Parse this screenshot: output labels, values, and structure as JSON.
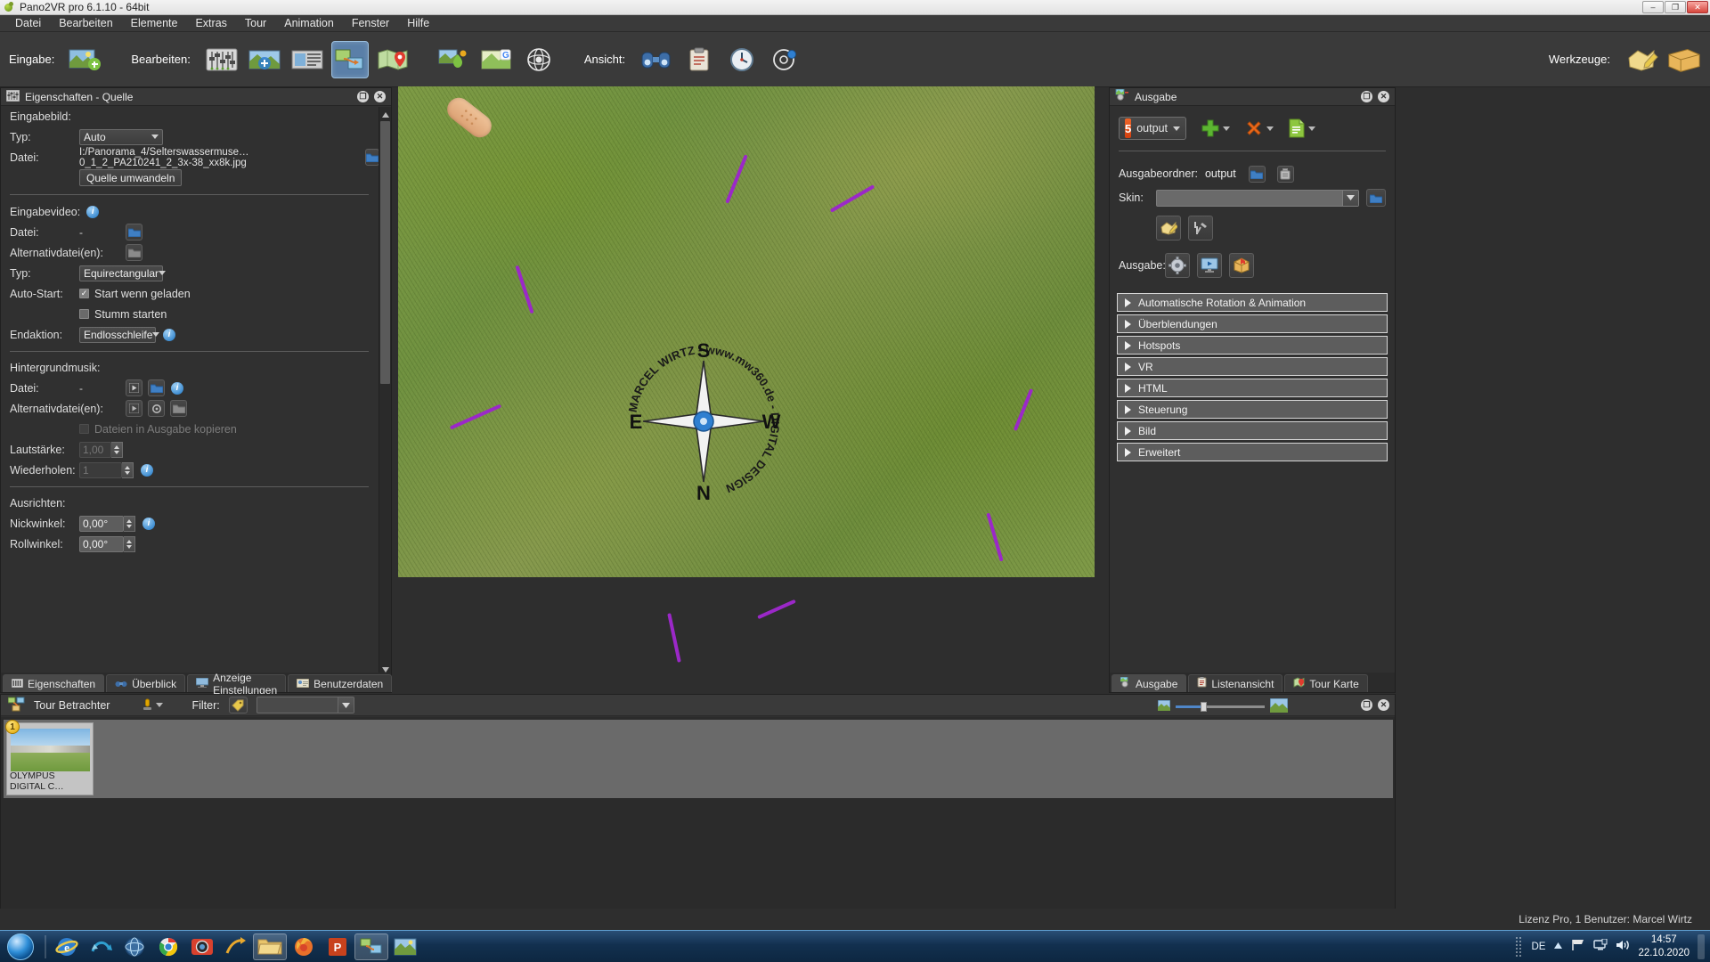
{
  "window": {
    "title": "Pano2VR pro 6.1.10 - 64bit",
    "minimize": "–",
    "maximize": "❐",
    "close": "✕"
  },
  "menu": [
    "Datei",
    "Bearbeiten",
    "Elemente",
    "Extras",
    "Tour",
    "Animation",
    "Fenster",
    "Hilfe"
  ],
  "toolbar": {
    "group_input": "Eingabe:",
    "group_edit": "Bearbeiten:",
    "group_view": "Ansicht:",
    "group_tools": "Werkzeuge:"
  },
  "left_panel": {
    "title": "Eigenschaften - Quelle",
    "icon": "sliders-icon",
    "sections": {
      "input_image": {
        "heading": "Eingabebild:",
        "type_label": "Typ:",
        "type_value": "Auto",
        "file_label": "Datei:",
        "file_value": "I:/Panorama_4/Selterswassermuse…0_1_2_PA210241_2_3x-38_xx8k.jpg",
        "convert_button": "Quelle umwandeln"
      },
      "input_video": {
        "heading": "Eingabevideo:",
        "file_label": "Datei:",
        "file_value": "-",
        "alt_label": "Alternativdatei(en):",
        "alt_value": "-",
        "type_label": "Typ:",
        "type_value": "Equirectangular",
        "autostart_label": "Auto-Start:",
        "autostart_check": "Start wenn geladen",
        "mute_check": "Stumm starten",
        "endaction_label": "Endaktion:",
        "endaction_value": "Endlosschleife"
      },
      "background_music": {
        "heading": "Hintergrundmusik:",
        "file_label": "Datei:",
        "file_value": "-",
        "alt_label": "Alternativdatei(en):",
        "alt_value": "-",
        "copy_check": "Dateien in Ausgabe kopieren",
        "volume_label": "Lautstärke:",
        "volume_value": "1,00",
        "repeat_label": "Wiederholen:",
        "repeat_value": "1"
      },
      "align": {
        "heading": "Ausrichten:",
        "pitch_label": "Nickwinkel:",
        "pitch_value": "0,00°",
        "roll_label": "Rollwinkel:",
        "roll_value": "0,00°"
      }
    },
    "tabs": [
      {
        "label": "Eigenschaften",
        "icon": "properties-icon",
        "active": true
      },
      {
        "label": "Überblick",
        "icon": "binoculars-icon",
        "active": false
      },
      {
        "label": "Anzeige Einstellungen",
        "icon": "display-icon",
        "active": false
      },
      {
        "label": "Benutzerdaten",
        "icon": "usercard-icon",
        "active": false
      }
    ]
  },
  "right_panel": {
    "title": "Ausgabe",
    "icon": "output-icon",
    "format_value": "output",
    "add_label": "+",
    "remove_label": "✕",
    "folder_label": "Ausgabeordner:",
    "folder_value": "output",
    "skin_label": "Skin:",
    "skin_value": "",
    "output_label": "Ausgabe:",
    "accordions": [
      "Automatische Rotation & Animation",
      "Überblendungen",
      "Hotspots",
      "VR",
      "HTML",
      "Steuerung",
      "Bild",
      "Erweitert"
    ],
    "tabs": [
      {
        "label": "Ausgabe",
        "icon": "output-icon",
        "active": true
      },
      {
        "label": "Listenansicht",
        "icon": "clipboard-icon",
        "active": false
      },
      {
        "label": "Tour Karte",
        "icon": "map-icon",
        "active": false
      }
    ]
  },
  "tour_panel": {
    "title": "Tour Betrachter",
    "icon": "tour-icon",
    "filter_label": "Filter:",
    "filter_value": "",
    "nodes": [
      {
        "index": "1",
        "caption": "OLYMPUS DIGITAL C…"
      }
    ]
  },
  "status": {
    "license": "Lizenz Pro, 1 Benutzer: Marcel Wirtz"
  },
  "taskbar": {
    "language": "DE",
    "time": "14:57",
    "date": "22.10.2020",
    "items": [
      "internet-explorer-icon",
      "sync-icon",
      "globe-icon",
      "chrome-icon",
      "camera-icon",
      "arrow-icon",
      "explorer-icon",
      "firefox-icon",
      "powerpoint-icon",
      "pano2vr-icon",
      "photo-icon"
    ],
    "tray": [
      "show-hidden-icon",
      "network-icon",
      "monitor-icon",
      "volume-icon"
    ]
  },
  "colors": {
    "accent": "#4f86c8",
    "panel_bg": "#303030",
    "toolbar_bg": "#3a3a3a",
    "highlight": "#9b28c8",
    "html5_orange": "#e44d26"
  }
}
